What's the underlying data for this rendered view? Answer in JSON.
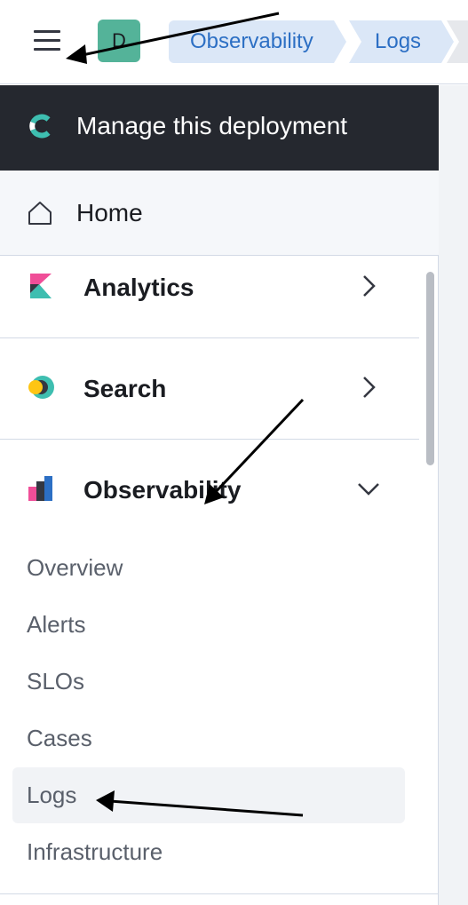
{
  "header": {
    "avatar_letter": "D",
    "breadcrumbs": [
      "Observability",
      "Logs"
    ]
  },
  "nav": {
    "deployment_label": "Manage this deployment",
    "home_label": "Home",
    "sections": [
      {
        "label": "Analytics",
        "icon": "kibana-icon",
        "state": "collapsed"
      },
      {
        "label": "Search",
        "icon": "search-solution-icon",
        "state": "collapsed"
      },
      {
        "label": "Observability",
        "icon": "observability-icon",
        "state": "expanded"
      }
    ],
    "observability_items": [
      "Overview",
      "Alerts",
      "SLOs",
      "Cases",
      "Logs",
      "Infrastructure"
    ],
    "active_item": "Logs"
  },
  "colors": {
    "breadcrumb_bg": "#dbe7f7",
    "breadcrumb_text": "#2c6fc4",
    "avatar_bg": "#54b399",
    "deployment_bg": "#25282f",
    "arrow": "#000000"
  }
}
